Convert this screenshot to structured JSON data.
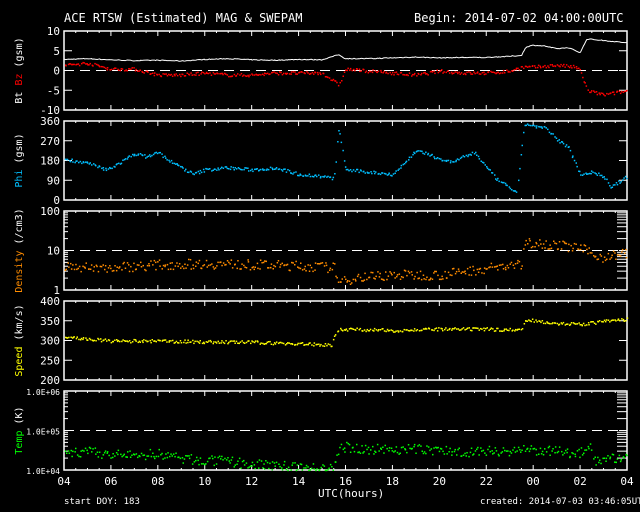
{
  "header": {
    "title": "ACE RTSW (Estimated) MAG & SWEPAM",
    "begin": "Begin: 2014-07-02 04:00:00UTC"
  },
  "footer": {
    "start_doy": "start DOY: 183",
    "created": "created: 2014-07-03 03:46:05UTC"
  },
  "chart_data": {
    "type": "scatter",
    "xlabel": "UTC(hours)",
    "x_range_hours": [
      0,
      24
    ],
    "x_tick_labels": [
      "04",
      "06",
      "08",
      "10",
      "12",
      "14",
      "16",
      "18",
      "20",
      "22",
      "00",
      "02",
      "04"
    ],
    "panels": [
      {
        "id": "mag",
        "ylabel_parts": [
          {
            "text": "Bt",
            "color": "#ffffff"
          },
          {
            "text": " Bz",
            "color": "#ff0000"
          },
          {
            "text": " (gsm)",
            "color": "#ffffff"
          }
        ],
        "scale": "linear",
        "ylim": [
          -10,
          10
        ],
        "ticks": [
          10,
          5,
          0,
          -5,
          -10
        ],
        "tick_labels": [
          "10",
          "5",
          "0",
          "-5",
          "-10"
        ],
        "dashed_at": 0,
        "series": [
          {
            "name": "Bt",
            "color": "#ffffff",
            "mode": "line",
            "x": [
              0,
              1,
              2,
              3,
              4,
              5,
              6,
              7,
              8,
              9,
              10,
              11,
              11.7,
              12,
              13,
              14,
              15,
              16,
              17,
              18,
              19,
              19.5,
              19.7,
              20,
              20.5,
              21,
              21.5,
              22,
              22.3,
              23,
              24
            ],
            "y": [
              2.8,
              3,
              2.7,
              2.5,
              2.6,
              2.4,
              2.8,
              3,
              2.7,
              2.6,
              2.8,
              2.7,
              4,
              3,
              3,
              3.2,
              3.4,
              3.2,
              3.3,
              3.3,
              3.6,
              3.8,
              6,
              6.4,
              6.2,
              5.5,
              5.8,
              4.5,
              8,
              7.6,
              7
            ]
          },
          {
            "name": "Bz",
            "color": "#ff0000",
            "mode": "dots",
            "x": [
              0,
              1,
              2,
              3,
              4,
              5,
              6,
              7,
              8,
              9,
              10,
              11,
              11.7,
              12,
              13,
              14,
              15,
              16,
              17,
              18,
              19,
              19.5,
              20,
              21,
              21.8,
              22,
              22.3,
              23,
              24
            ],
            "y": [
              1.5,
              2,
              0.5,
              0.5,
              -1,
              -1,
              -0.5,
              -1,
              -1,
              -0.5,
              -0.5,
              -0.5,
              -3.5,
              0.5,
              0,
              -0.5,
              -1,
              0,
              -0.5,
              -0.5,
              0,
              1,
              1,
              1.5,
              1,
              0,
              -5,
              -6,
              -5
            ]
          }
        ]
      },
      {
        "id": "phi",
        "ylabel_parts": [
          {
            "text": "Phi",
            "color": "#00bfff"
          },
          {
            "text": " (gsm)",
            "color": "#ffffff"
          }
        ],
        "scale": "linear",
        "ylim": [
          0,
          360
        ],
        "ticks": [
          360,
          270,
          180,
          90,
          0
        ],
        "tick_labels": [
          "360",
          "270",
          "180",
          "90",
          "0"
        ],
        "series": [
          {
            "name": "Phi",
            "color": "#00bfff",
            "mode": "dots",
            "x": [
              0,
              1,
              1.8,
              2.5,
              3,
              3.5,
              4,
              4.5,
              5.5,
              6,
              7,
              8,
              9,
              10,
              11,
              11.5,
              11.7,
              12,
              13,
              14,
              14.5,
              15,
              16,
              16.5,
              17.5,
              18,
              18.5,
              19,
              19.3,
              19.6,
              20,
              20.5,
              21,
              21.5,
              22,
              22.5,
              23,
              23.3,
              24
            ],
            "y": [
              190,
              170,
              140,
              180,
              215,
              200,
              220,
              180,
              120,
              140,
              150,
              140,
              150,
              120,
              110,
              100,
              330,
              140,
              130,
              120,
              170,
              230,
              190,
              175,
              220,
              150,
              90,
              60,
              30,
              350,
              340,
              330,
              280,
              240,
              120,
              130,
              110,
              60,
              110
            ]
          }
        ]
      },
      {
        "id": "density",
        "ylabel_parts": [
          {
            "text": "Density",
            "color": "#ff8c00"
          },
          {
            "text": " (/cm3)",
            "color": "#ffffff"
          }
        ],
        "scale": "log",
        "ylim": [
          1,
          100
        ],
        "ticks": [
          100,
          10,
          1
        ],
        "tick_labels": [
          "100",
          "10",
          "1"
        ],
        "dashed_at": 10,
        "series": [
          {
            "name": "Density",
            "color": "#ff8c00",
            "mode": "dots",
            "x": [
              0,
              2,
              4,
              6,
              8,
              10,
              11.5,
              11.7,
              12.5,
              14,
              16,
              17,
              18.5,
              19.5,
              19.6,
              20,
              21,
              22,
              22.5,
              23,
              24
            ],
            "y": [
              4,
              3.8,
              4.5,
              4.8,
              4.5,
              4.2,
              3.8,
              1.5,
              2.2,
              2.5,
              2.5,
              3,
              4,
              4.5,
              15,
              17,
              14,
              12,
              8,
              7,
              9
            ]
          }
        ]
      },
      {
        "id": "speed",
        "ylabel_parts": [
          {
            "text": "Speed",
            "color": "#ffff00"
          },
          {
            "text": " (km/s)",
            "color": "#ffffff"
          }
        ],
        "scale": "linear",
        "ylim": [
          200,
          400
        ],
        "ticks": [
          400,
          350,
          300,
          250,
          200
        ],
        "tick_labels": [
          "400",
          "350",
          "300",
          "250",
          "200"
        ],
        "series": [
          {
            "name": "Speed",
            "color": "#ffff00",
            "mode": "dots",
            "x": [
              0,
              1,
              2,
              4,
              6,
              8,
              10,
              11.4,
              11.6,
              12,
              14,
              16,
              18,
              19.5,
              19.6,
              20,
              21,
              22,
              23,
              24
            ],
            "y": [
              310,
              305,
              300,
              300,
              298,
              297,
              293,
              290,
              328,
              330,
              327,
              330,
              330,
              328,
              350,
              352,
              345,
              342,
              350,
              355
            ]
          }
        ]
      },
      {
        "id": "temp",
        "ylabel_parts": [
          {
            "text": "Temp",
            "color": "#00ff00"
          },
          {
            "text": " (K)",
            "color": "#ffffff"
          }
        ],
        "scale": "log",
        "ylim": [
          10000,
          1000000
        ],
        "ticks": [
          1000000,
          100000,
          10000
        ],
        "tick_labels": [
          "1.0E+06",
          "1.0E+05",
          "1.0E+04"
        ],
        "dashed_at": 100000,
        "series": [
          {
            "name": "Temp",
            "color": "#00ff00",
            "mode": "dots",
            "x": [
              0,
              1,
              2,
              3,
              4,
              5,
              6,
              7,
              8,
              9,
              10,
              11,
              11.5,
              11.8,
              13,
              15,
              17,
              19,
              20,
              21,
              22,
              22.4,
              22.6,
              24
            ],
            "y": [
              28000,
              30000,
              25000,
              24000,
              27000,
              20000,
              18000,
              17000,
              14000,
              14000,
              12000,
              11000,
              11000,
              40000,
              35000,
              35000,
              30000,
              32000,
              33000,
              30000,
              28000,
              45000,
              18000,
              22000
            ]
          }
        ]
      }
    ]
  }
}
